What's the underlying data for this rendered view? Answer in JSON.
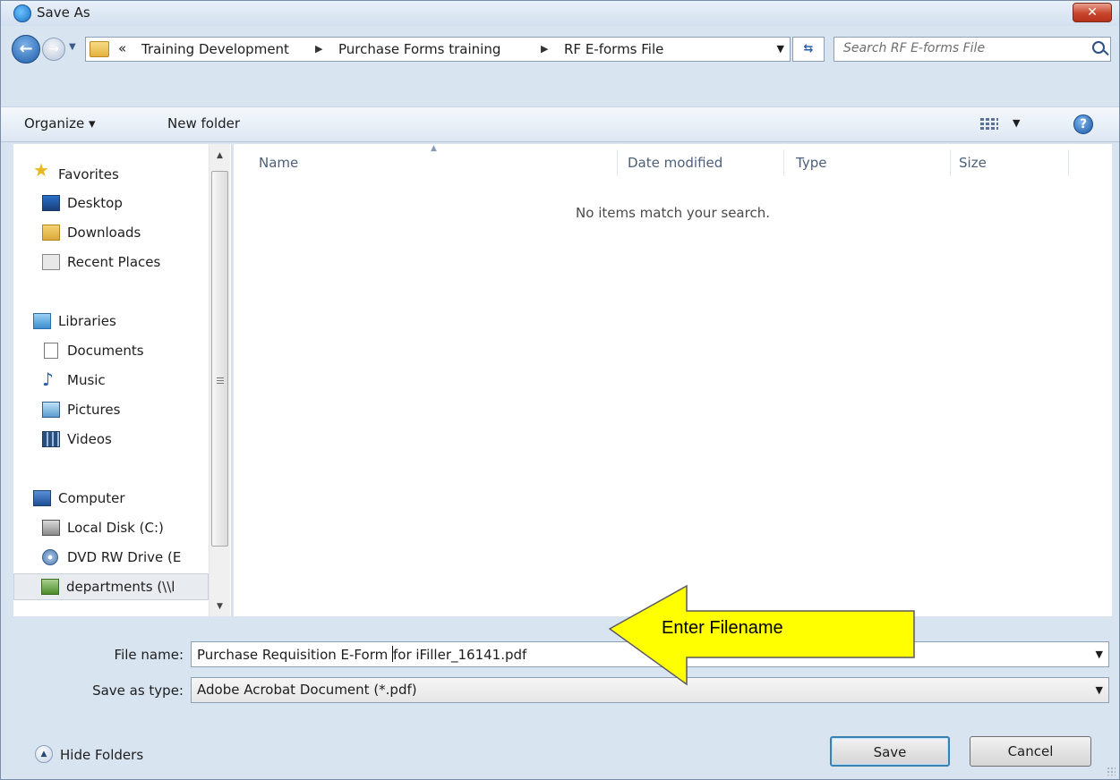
{
  "window": {
    "title": "Save As"
  },
  "address": {
    "chevron": "«",
    "breadcrumbs": [
      "Training Development",
      "Purchase Forms training",
      "RF E-forms File"
    ],
    "search_placeholder": "Search RF E-forms File"
  },
  "toolbar": {
    "organize_label": "Organize ▾",
    "new_folder_label": "New folder"
  },
  "nav": {
    "favorites": {
      "label": "Favorites",
      "items": [
        "Desktop",
        "Downloads",
        "Recent Places"
      ]
    },
    "libraries": {
      "label": "Libraries",
      "items": [
        "Documents",
        "Music",
        "Pictures",
        "Videos"
      ]
    },
    "computer": {
      "label": "Computer",
      "items": [
        "Local Disk (C:)",
        "DVD RW Drive (E",
        "departments (\\\\l"
      ]
    }
  },
  "file_list": {
    "columns": [
      "Name",
      "Date modified",
      "Type",
      "Size"
    ],
    "empty_message": "No items match your search."
  },
  "form": {
    "file_name_label": "File name:",
    "file_name_value_a": "Purchase Requisition E-Form ",
    "file_name_value_b": "for iFiller_16141.pdf",
    "save_type_label": "Save as type:",
    "save_type_value": "Adobe Acrobat Document (*.pdf)"
  },
  "callout": {
    "text": "Enter Filename",
    "fill": "#ffff00"
  },
  "footer": {
    "hide_folders_label": "Hide Folders",
    "save_label": "Save",
    "cancel_label": "Cancel"
  },
  "icons": [
    "ie-icon",
    "close-icon",
    "back-arrow-icon",
    "forward-arrow-icon",
    "folder-icon",
    "refresh-icon",
    "search-icon",
    "views-icon",
    "help-icon",
    "star-icon",
    "desktop-icon",
    "downloads-icon",
    "recent-places-icon",
    "libraries-icon",
    "documents-icon",
    "music-icon",
    "pictures-icon",
    "videos-icon",
    "computer-icon",
    "local-disk-icon",
    "dvd-drive-icon",
    "network-drive-icon"
  ]
}
